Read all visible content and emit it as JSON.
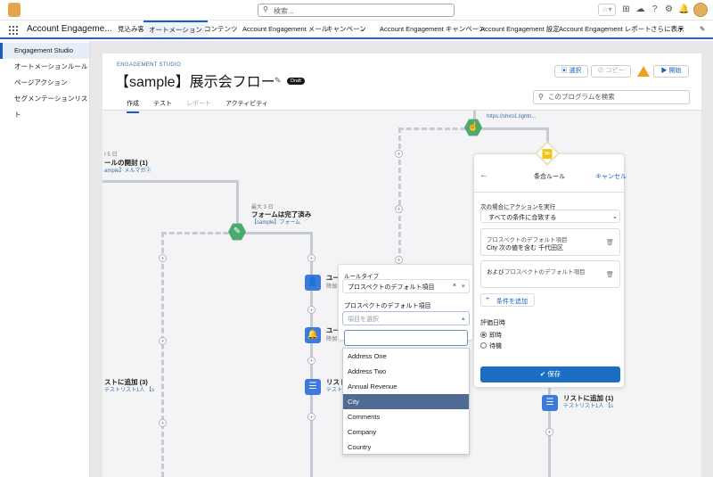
{
  "search": {
    "placeholder": "検索..."
  },
  "app": {
    "name": "Account Engageme..."
  },
  "nav": {
    "items": [
      "見込み客",
      "オートメーション",
      "コンテンツ",
      "Account Engagement メール",
      "キャンペーン",
      "Account Engagement キャンペーン",
      "Account Engagement 設定",
      "Account Engagement レポート",
      "さらに表示"
    ]
  },
  "sidebar": {
    "items": [
      "Engagement Studio",
      "オートメーションルール",
      "ページアクション",
      "セグメンテーションリスト"
    ]
  },
  "header": {
    "eyebrow": "ENGAGEMENT STUDIO",
    "title": "【sample】展示会フロー",
    "badge": "Draft",
    "select_btn": "選択",
    "copy_btn": "コピー",
    "start_btn": "開始",
    "search_placeholder": "このプログラムを検索"
  },
  "tabs": [
    "作成",
    "テスト",
    "レポート",
    "アクティビティ"
  ],
  "flow": {
    "n1_wait": "Ⅰ 5 日",
    "n1_title": "ールの開封 (1)",
    "n1_sub": "ample】メルマガ②",
    "n2_wait": "最大 3 日",
    "n2_title": "フォームは完了済み",
    "n2_sub": "【sample】フォーム",
    "n3_title": "ユー",
    "n3_sub": "降伽",
    "n4_title": "ユー",
    "n4_sub": "降伽",
    "n5_title": "リスト",
    "n5_sub": "テストリ",
    "n6_title": "ストに追加 (3)",
    "n6_sub": "テストリスト1人 【s",
    "n7_title": "リストに追加 (1)",
    "n7_sub": "テストリスト1人 【s",
    "n8_title": "https://shiro1.lightn..."
  },
  "rule_panel": {
    "title": "条合ルール",
    "cancel": "キャンセル",
    "exec_label": "次の場合にアクションを実行",
    "exec_value": "すべての条件に合致する",
    "cond1_label": "プロスペクトのデフォルト項目",
    "cond1_value": "City 次の値を含む 千代田区",
    "cond2_prefix": "および",
    "cond2_label": "プロスペクトのデフォルト項目",
    "add_cond": "条件を追加",
    "timing_label": "評価日時",
    "radio1": "即時",
    "radio2": "待機",
    "save": "保存"
  },
  "rule_popup": {
    "type_label": "ルールタイプ",
    "type_value": "プロスペクトのデフォルト項目",
    "field_label": "プロスペクトのデフォルト項目",
    "field_placeholder": "項目を選択"
  },
  "dropdown": {
    "options": [
      "Address One",
      "Address Two",
      "Annual Revenue",
      "City",
      "Comments",
      "Company",
      "Country"
    ],
    "highlighted": "City"
  }
}
